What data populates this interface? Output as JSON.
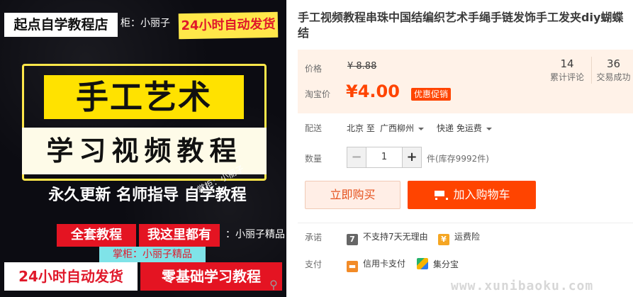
{
  "image": {
    "store_name": "起点自学教程店",
    "watermark_top": "柜：小丽子",
    "auto_ship_top": "24小时自动发货",
    "main_title": "手工艺术",
    "course_banner": "学习视频教程",
    "features": "永久更新 名师指导 自学教程",
    "watermark_mid": "掌柜：小丽子",
    "red_tag_1": "全套教程",
    "red_tag_2": "我这里都有",
    "watermark_shop": "：小丽子精品",
    "watermark_keeper": "掌柜：小丽子精品",
    "auto_ship_bottom": "24小时自动发货",
    "zero_basis": "零基础学习教程"
  },
  "product": {
    "title": "手工视频教程串珠中国结编织艺术手绳手链发饰手工发夹diy蝴蝶结"
  },
  "price": {
    "label": "价格",
    "original": "¥ 8.88",
    "taobao_label": "淘宝价",
    "taobao_price": "¥4.00",
    "promo_badge": "优惠促销"
  },
  "stats": {
    "comments_count": "14",
    "comments_label": "累计评论",
    "sales_count": "36",
    "sales_label": "交易成功"
  },
  "delivery": {
    "label": "配送",
    "from": "北京 至",
    "to": "广西柳州",
    "method": "快递 免运费"
  },
  "quantity": {
    "label": "数量",
    "minus": "−",
    "value": "1",
    "plus": "+",
    "stock": "件(库存9992件)"
  },
  "actions": {
    "buy_now": "立即购买",
    "add_cart": "加入购物车"
  },
  "promise": {
    "label": "承诺",
    "no_return": "不支持7天无理由",
    "no_return_icon": "7",
    "freight_insurance": "运费险"
  },
  "payment": {
    "label": "支付",
    "credit_card": "信用卡支付",
    "jifenbao": "集分宝"
  },
  "site_watermark": "www.xunibaoku.com"
}
